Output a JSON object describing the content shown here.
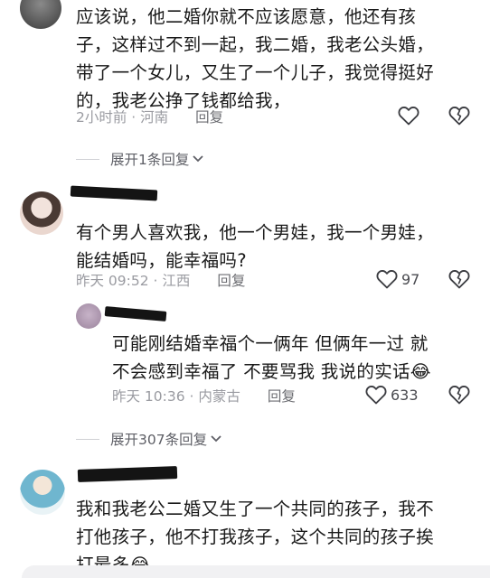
{
  "comments": [
    {
      "text_lines": [
        "应该说，他二婚你就不应该愿意，他还有孩",
        "子，这样过不到一起，我二婚，我老公头婚，",
        "带了一个女儿，又生了一个儿子，我觉得挺好",
        "的，我老公挣了钱都给我，"
      ],
      "time": "2小时前 · 河南",
      "reply_label": "回复",
      "like_count": ""
    },
    {
      "text_lines": [
        "有个男人喜欢我，他一个男娃，我一个男娃，",
        "能结婚吗，能幸福吗?"
      ],
      "time": "昨天 09:52 · 江西",
      "reply_label": "回复",
      "like_count": "97"
    },
    {
      "text_lines": [
        "可能刚结婚幸福个一俩年   但俩年一过 就",
        "不会感到幸福了  不要骂我 我说的实话😂"
      ],
      "time": "昨天 10:36 · 内蒙古",
      "reply_label": "回复",
      "like_count": "633"
    },
    {
      "text_lines": [
        "我和我老公二婚又生了一个共同的孩子，我不",
        "打他孩子，他不打我孩子，这个共同的孩子挨",
        "打最多😂"
      ],
      "time": "",
      "reply_label": "",
      "like_count": ""
    }
  ],
  "expand_1": "展开1条回复",
  "expand_2": "展开307条回复",
  "icons": {
    "like": "heart-outline-icon",
    "dislike": "broken-heart-icon",
    "chevron": "chevron-down-icon"
  }
}
